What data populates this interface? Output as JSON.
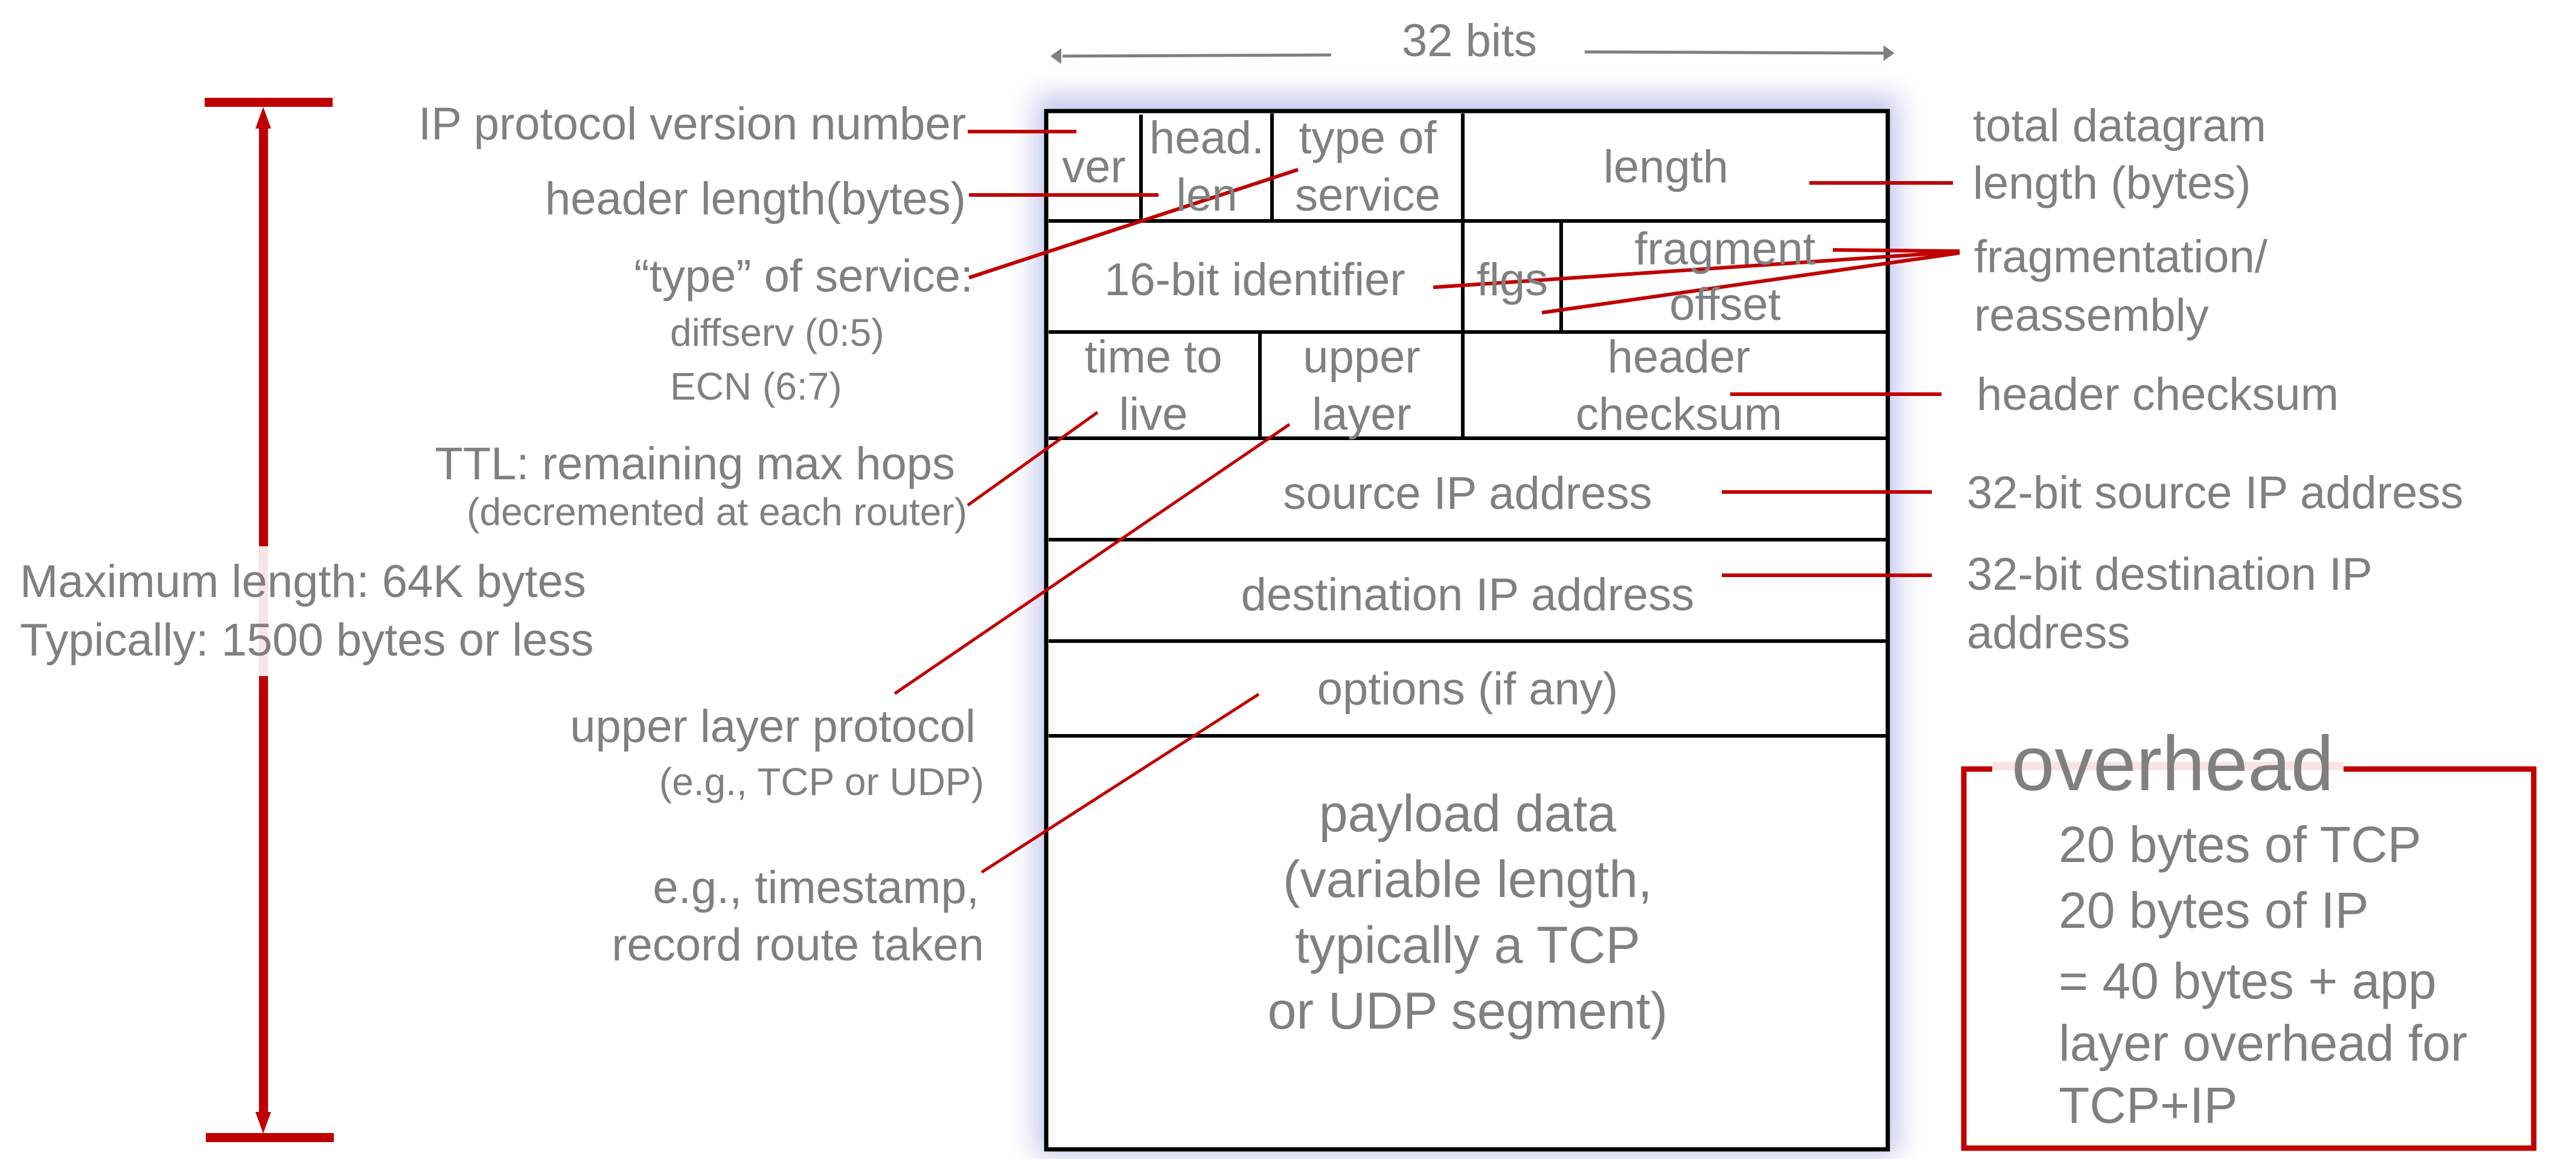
{
  "width_label": "32 bits",
  "max_length": {
    "line1": "Maximum length: 64K bytes",
    "line2": "Typically: 1500 bytes or less"
  },
  "left_labels": {
    "version": "IP protocol version number",
    "header_length": "header length(bytes)",
    "tos_title": "“type” of service:",
    "tos_diffserv": "diffserv (0:5)",
    "tos_ecn": "ECN (6:7)",
    "ttl_title": "TTL: remaining  max hops",
    "ttl_sub": "(decremented at each router)",
    "upper_title": "upper layer protocol",
    "upper_sub": "(e.g., TCP or UDP)",
    "options_line1": "e.g., timestamp,",
    "options_line2": "record route taken"
  },
  "header_fields": {
    "ver": "ver",
    "head_len_1": "head.",
    "head_len_2": "len",
    "tos_1": "type of",
    "tos_2": "service",
    "length": "length",
    "identifier": "16-bit identifier",
    "flags": "flgs",
    "frag_1": "fragment",
    "frag_2": "offset",
    "ttl_1": "time to",
    "ttl_2": "live",
    "upper_1": "upper",
    "upper_2": "layer",
    "checksum_1": "header",
    "checksum_2": "checksum",
    "source": "source IP address",
    "destination": "destination IP address",
    "options": "options (if any)",
    "payload": [
      "payload data",
      "(variable length,",
      "typically a TCP",
      "or UDP segment)"
    ]
  },
  "right_labels": {
    "total_length_1": "total datagram",
    "total_length_2": "length (bytes)",
    "frag_1": "fragmentation/",
    "frag_2": "reassembly",
    "checksum": "header checksum",
    "source": "32-bit source IP address",
    "dest_1": "32-bit destination IP",
    "dest_2": "address"
  },
  "overhead": {
    "title": "overhead",
    "lines": [
      "20 bytes of TCP",
      "20 bytes of IP",
      "= 40 bytes + app",
      "layer overhead for",
      "TCP+IP"
    ]
  },
  "colors": {
    "accent_red": "#c00000",
    "text_gray": "#808080",
    "border_black": "#000000",
    "glow_blue": "#9698dc"
  }
}
